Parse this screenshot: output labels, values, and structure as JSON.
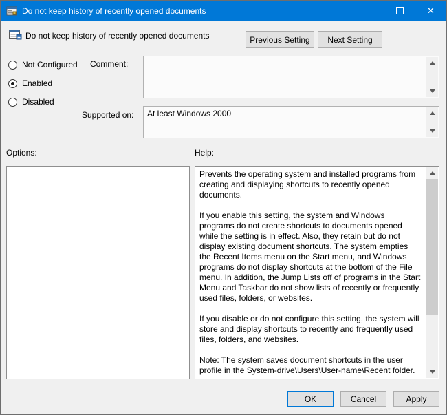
{
  "window": {
    "title": "Do not keep history of recently opened documents",
    "controls": {
      "maximize_glyph": "",
      "close_glyph": "✕"
    }
  },
  "header": {
    "setting_name": "Do not keep history of recently opened documents",
    "previous_button": "Previous Setting",
    "next_button": "Next Setting"
  },
  "state_options": [
    {
      "label": "Not Configured",
      "selected": false
    },
    {
      "label": "Enabled",
      "selected": true
    },
    {
      "label": "Disabled",
      "selected": false
    }
  ],
  "comment": {
    "label": "Comment:",
    "value": ""
  },
  "supported": {
    "label": "Supported on:",
    "value": "At least Windows 2000"
  },
  "options_panel": {
    "label": "Options:"
  },
  "help_panel": {
    "label": "Help:",
    "text": "Prevents the operating system and installed programs from creating and displaying shortcuts to recently opened documents.\n\nIf you enable this setting, the system and Windows programs do not create shortcuts to documents opened while the setting is in effect. Also, they retain but do not display existing document shortcuts. The system empties the Recent Items menu on the Start menu, and Windows programs do not display shortcuts at the bottom of the File menu. In addition, the Jump Lists off of programs in the Start Menu and Taskbar do not show lists of recently or frequently used files, folders, or websites.\n\nIf you disable or do not configure this setting, the system will store and display shortcuts to recently and frequently used files, folders, and websites.\n\nNote: The system saves document shortcuts in the user profile in the System-drive\\Users\\User-name\\Recent folder.\n\nAlso, see the \"Remove Recent Items menu from Start Menu\" and \"Clear history of recently opened documents on exit\" policies in"
  },
  "footer": {
    "ok": "OK",
    "cancel": "Cancel",
    "apply": "Apply"
  },
  "colors": {
    "titlebar": "#0078d7",
    "accent_border": "#0078d7",
    "dialog_bg": "#f0f0f0"
  }
}
